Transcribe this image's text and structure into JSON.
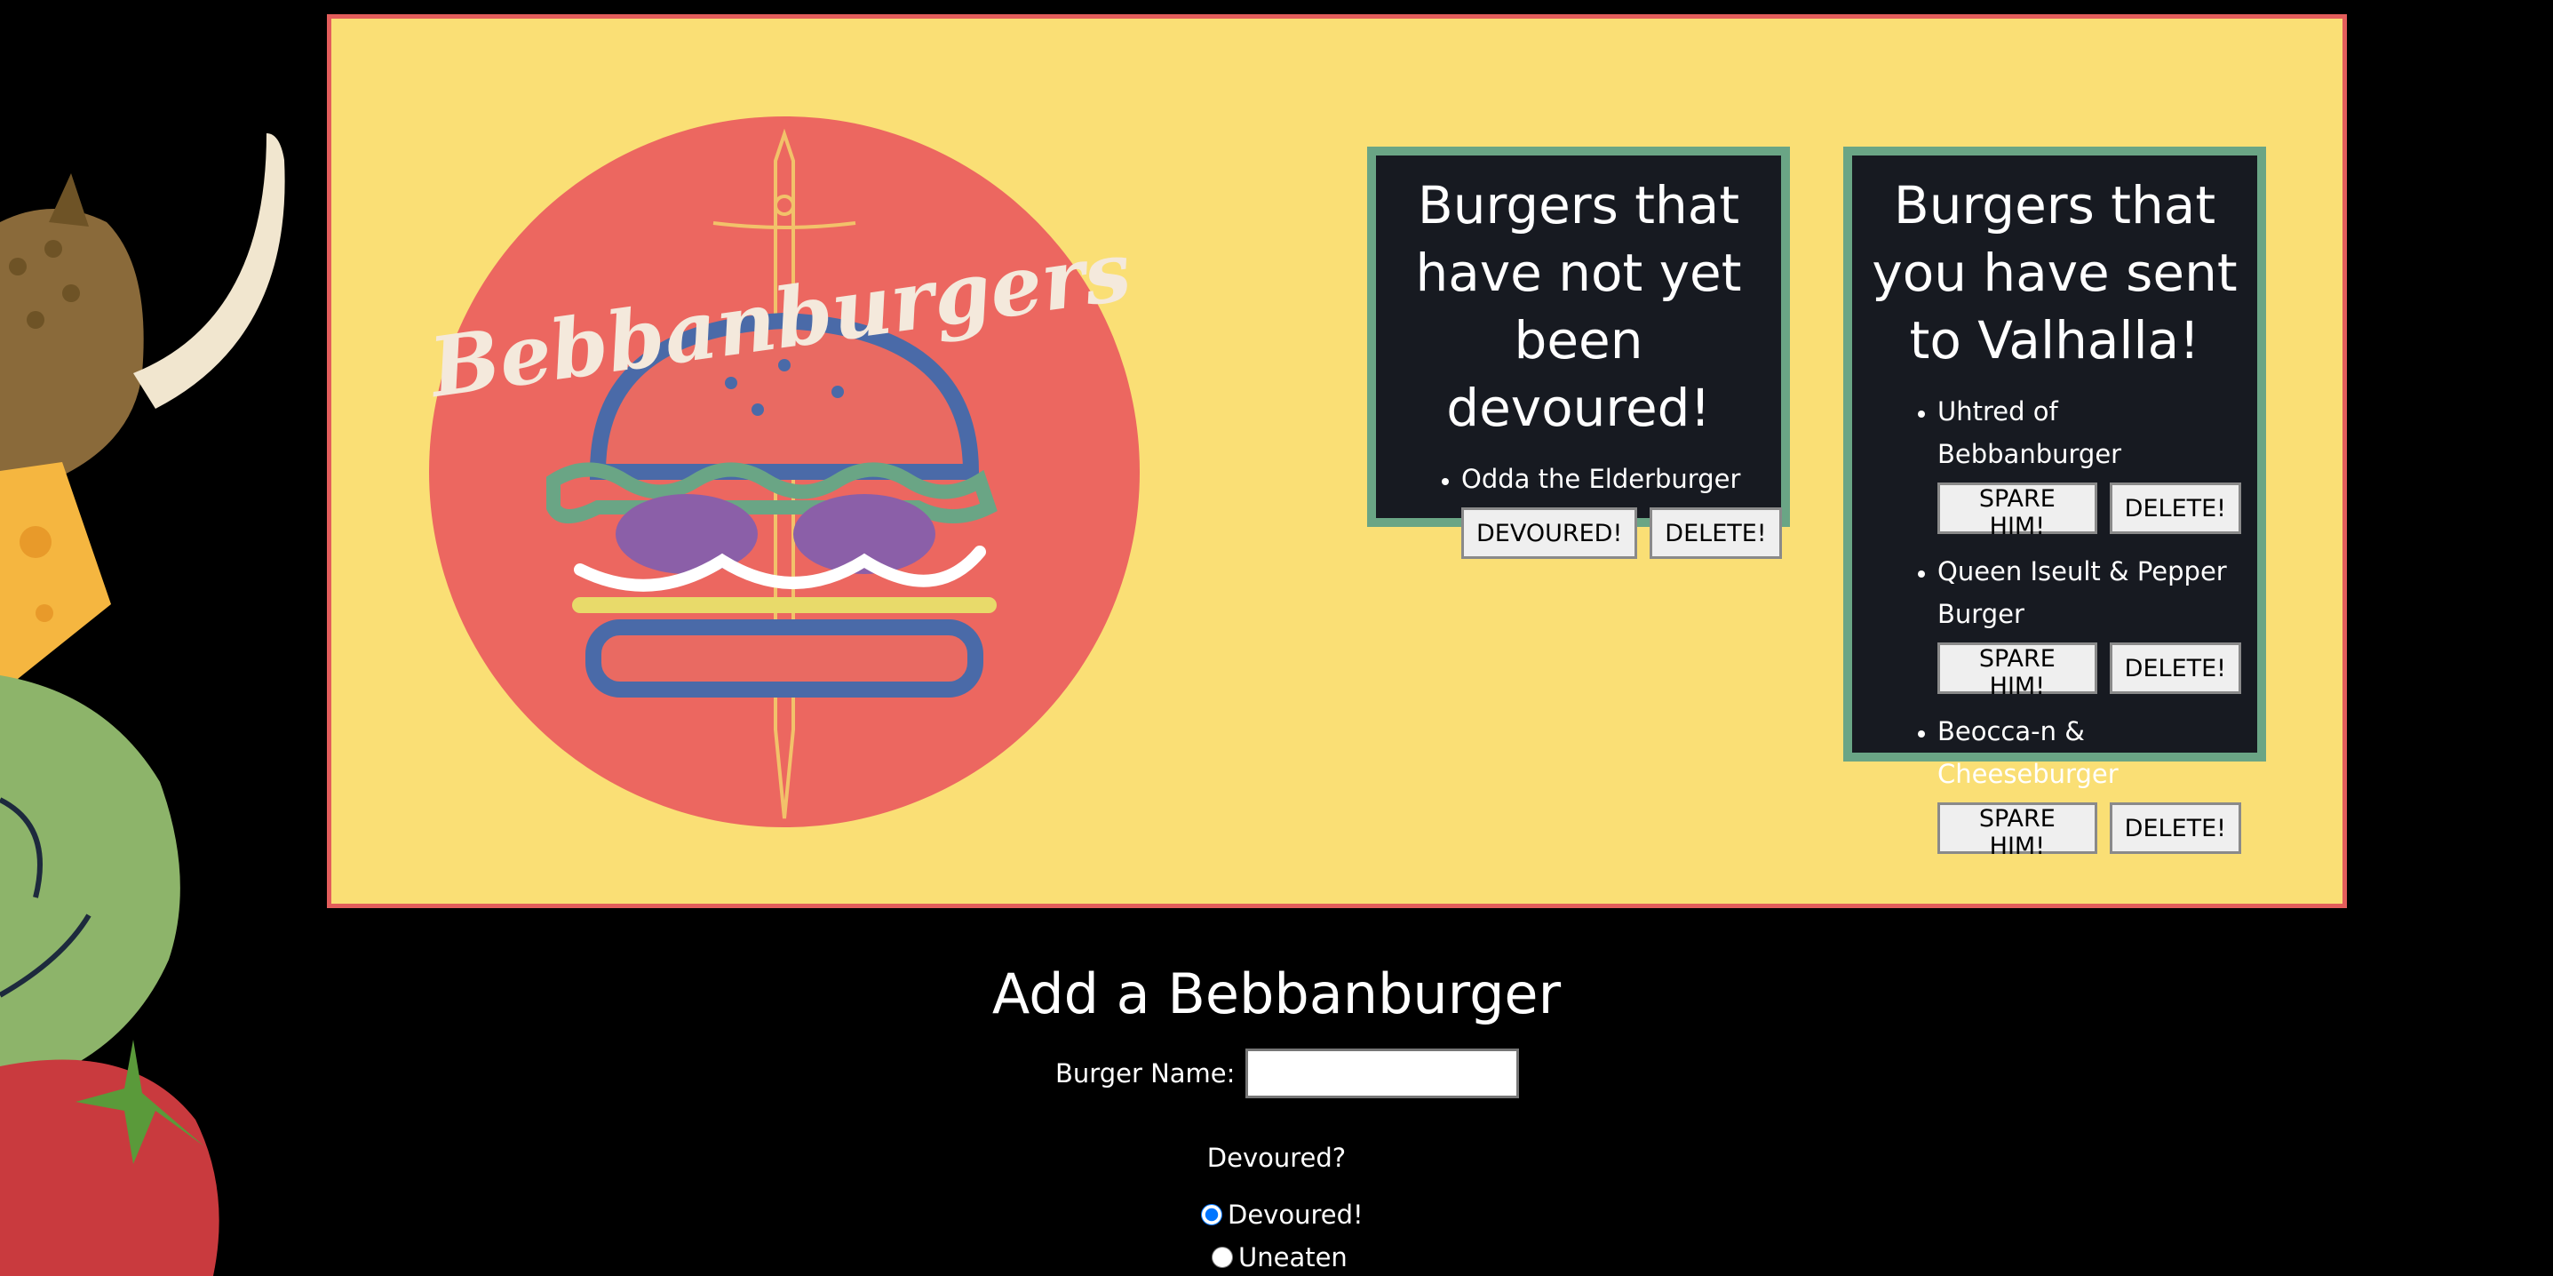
{
  "logo": {
    "text": "Bebbanburgers",
    "icon": "burger-sword-logo"
  },
  "uneaten": {
    "title": "Burgers that have not yet been devoured!",
    "items": [
      {
        "name": "Odda the Elderburger",
        "primary_btn": "DEVOURED!",
        "delete_btn": "DELETE!"
      }
    ]
  },
  "devoured": {
    "title": "Burgers that you have sent to Valhalla!",
    "items": [
      {
        "name": "Uhtred of Bebbanburger",
        "primary_btn": "SPARE HIM!",
        "delete_btn": "DELETE!"
      },
      {
        "name": "Queen Iseult & Pepper Burger",
        "primary_btn": "SPARE HIM!",
        "delete_btn": "DELETE!"
      },
      {
        "name": "Beocca-n & Cheeseburger",
        "primary_btn": "SPARE HIM!",
        "delete_btn": "DELETE!"
      }
    ]
  },
  "form": {
    "title": "Add a Bebbanburger",
    "name_label": "Burger Name:",
    "name_value": "",
    "devoured_question": "Devoured?",
    "options": [
      {
        "label": "Devoured!",
        "checked": true
      },
      {
        "label": "Uneaten",
        "checked": false
      }
    ]
  },
  "colors": {
    "panel_bg": "#fadf75",
    "panel_border": "#e35d5b",
    "box_bg": "#171a21",
    "box_border": "#6aa585",
    "logo_circle": "#ec6760",
    "page_bg": "#000000"
  }
}
